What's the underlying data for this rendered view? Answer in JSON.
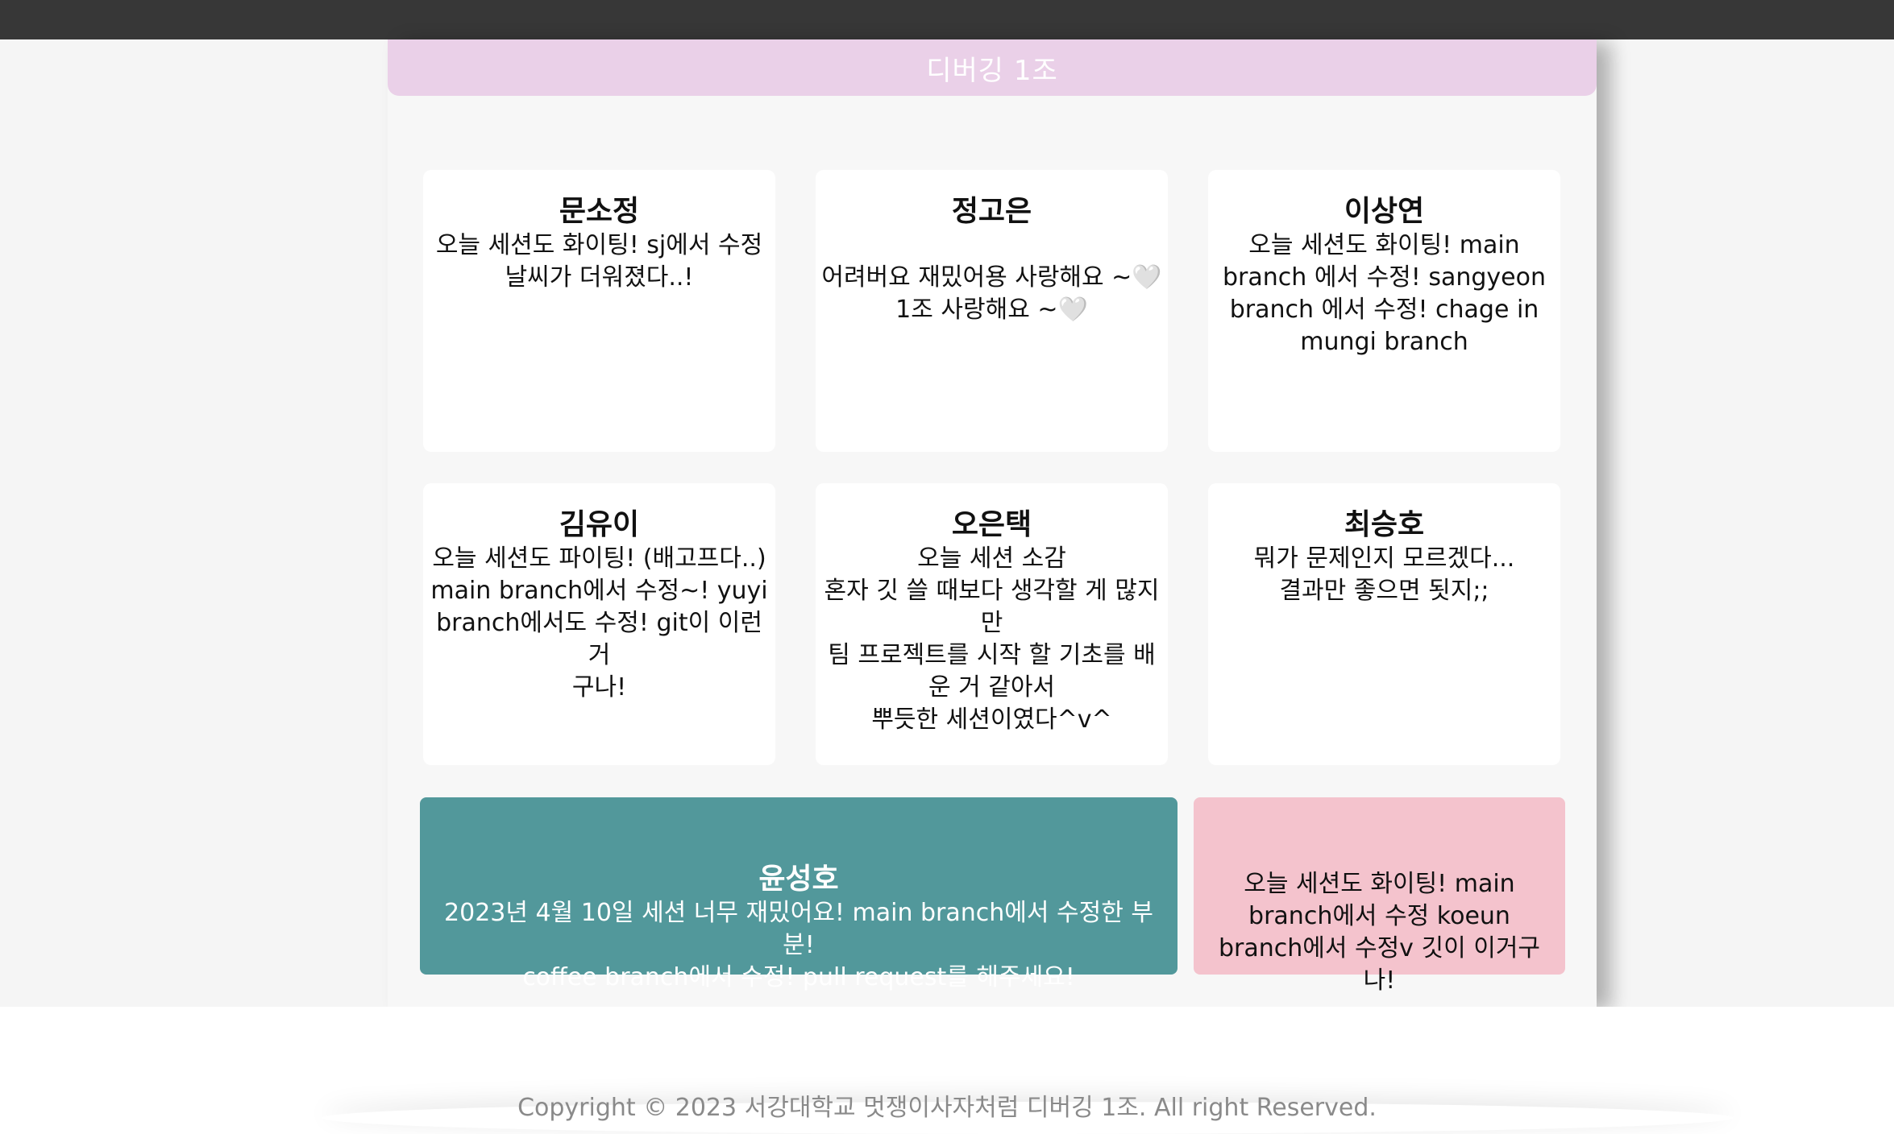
{
  "header": {
    "title": "디버깅 1조"
  },
  "cards": [
    {
      "name": "문소정",
      "message": "오늘 세션도 화이팅! sj에서 수정\n날씨가 더워졌다..!"
    },
    {
      "name": "정고은",
      "message": "어려버요 재밌어용 사랑해요 ~🤍\n1조 사랑해요 ~🤍"
    },
    {
      "name": "이상연",
      "message": "오늘 세션도 화이팅! main\nbranch 에서 수정! sangyeon\nbranch 에서 수정! chage in\nmungi branch"
    },
    {
      "name": "김유이",
      "message": "오늘 세션도 파이팅! (배고프다..)\nmain branch에서 수정~! yuyi\nbranch에서도 수정! git이 이런 거\n구나!"
    },
    {
      "name": "오은택",
      "message": "오늘 세션 소감\n혼자 깃 쓸 때보다 생각할 게 많지\n만\n팀 프로젝트를 시작 할 기초를 배\n운 거 같아서\n뿌듯한 세션이였다^v^"
    },
    {
      "name": "최승호",
      "message": "뭐가 문제인지 모르겠다...\n결과만 좋으면 됫지;;"
    }
  ],
  "wide_card": {
    "name": "윤성호",
    "message": "2023년 4월 10일 세션 너무 재밌어요! main branch에서 수정한 부분!\ncoffee branch에서 수정! pull request를 해주세요!"
  },
  "pink_card": {
    "message": "오늘 세션도 화이팅! main\nbranch에서 수정 koeun\nbranch에서 수정v 깃이 이거구\n나!"
  },
  "footer": {
    "copyright": "Copyright © 2023 서강대학교 멋쟁이사자처럼 디버깅 1조. All right Reserved."
  },
  "colors": {
    "topbar": "#373737",
    "header": "#ead0e8",
    "wide_card": "#52989b",
    "pink_card": "#f4c3cd"
  }
}
